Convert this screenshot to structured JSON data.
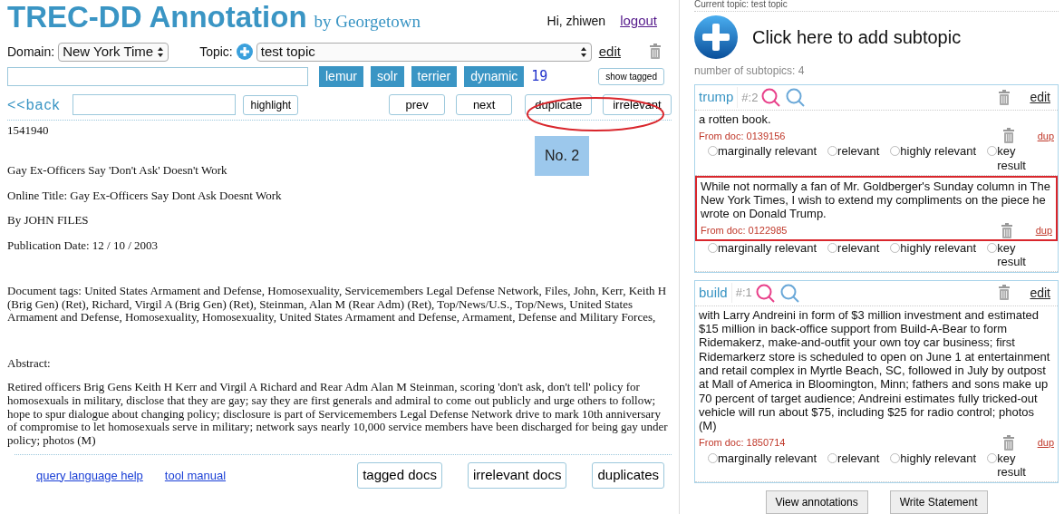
{
  "header": {
    "title": "TREC-DD Annotation",
    "subtitle": "by Georgetown",
    "greeting": "Hi, zhiwen",
    "logout": "logout"
  },
  "controls": {
    "domain_label": "Domain:",
    "domain_value": "New York Time",
    "topic_label": "Topic:",
    "topic_value": "test topic",
    "edit": "edit"
  },
  "search": {
    "engines": [
      {
        "label": "lemur"
      },
      {
        "label": "solr"
      },
      {
        "label": "terrier"
      },
      {
        "label": "dynamic"
      }
    ],
    "count": "19",
    "show_tagged": "show tagged"
  },
  "nav": {
    "back": "<<back",
    "highlight": "highlight",
    "buttons": [
      {
        "label": "prev",
        "circled": false
      },
      {
        "label": "next",
        "circled": false
      },
      {
        "label": "duplicate",
        "circled": true
      },
      {
        "label": "irrelevant",
        "circled": true
      }
    ]
  },
  "document": {
    "id": "1541940",
    "rank_badge": "No. 2",
    "paragraphs": [
      {
        "kind": "line",
        "text": "Gay Ex-Officers Say 'Don't Ask' Doesn't Work"
      },
      {
        "kind": "line",
        "text": "Online Title: Gay Ex-Officers Say Dont Ask Doesnt Work"
      },
      {
        "kind": "line",
        "text": "By JOHN FILES"
      },
      {
        "kind": "line",
        "text": "Publication Date: 12 / 10 / 2003"
      },
      {
        "kind": "block",
        "text": "Document tags: United States Armament and Defense, Homosexuality, Servicemembers Legal Defense Network, Files, John, Kerr, Keith H (Brig Gen) (Ret), Richard, Virgil A (Brig Gen) (Ret), Steinman, Alan M (Rear Adm) (Ret), Top/News/U.S., Top/News, United States Armament and Defense, Homosexuality, Homosexuality, United States Armament and Defense, Armament, Defense and Military Forces,"
      },
      {
        "kind": "block",
        "text": "Abstract:"
      },
      {
        "kind": "line",
        "text": "Retired officers Brig Gens Keith H Kerr and Virgil A Richard and Rear Adm Alan M Steinman, scoring 'don't ask, don't tell' policy for homosexuals in military, disclose that they are gay; say they are first generals and admiral to come out publicly and urge others to follow; hope to spur dialogue about changing policy; disclosure is part of Servicemembers Legal Defense Network drive to mark 10th anniversary of compromise to let homosexuals serve in military; network says nearly 10,000 service members have been discharged for being gay under policy; photos (M)"
      }
    ]
  },
  "footer": {
    "links": [
      "query language help",
      "tool manual"
    ],
    "buttons": [
      "tagged docs",
      "irrelevant docs",
      "duplicates"
    ]
  },
  "panel": {
    "current_topic": "Current topic: test topic",
    "add_subtopic": "Click here to add subtopic",
    "count": "number of subtopics: 4",
    "subtopics": [
      {
        "name": "trump",
        "number": "#:2",
        "edit": "edit",
        "snippets": [
          {
            "text": "a rotten book.",
            "source": "From doc: 0139156",
            "dup": "dup",
            "highlighted": false,
            "grades": [
              {
                "label": "marginally relevant",
                "selected": false
              },
              {
                "label": "relevant",
                "selected": false
              },
              {
                "label": "highly relevant",
                "selected": false
              },
              {
                "label": "key result",
                "selected": false
              }
            ]
          },
          {
            "text": "While not normally a fan of Mr. Goldberger's Sunday column in The New York Times, I wish to extend my compliments on the piece he wrote on Donald Trump.",
            "source": "From doc: 0122985",
            "dup": "dup",
            "highlighted": true,
            "grades": [
              {
                "label": "marginally relevant",
                "selected": false
              },
              {
                "label": "relevant",
                "selected": false
              },
              {
                "label": "highly relevant",
                "selected": false
              },
              {
                "label": "key result",
                "selected": false
              }
            ]
          }
        ]
      },
      {
        "name": "build",
        "number": "#:1",
        "edit": "edit",
        "snippets": [
          {
            "text": "with Larry Andreini in form of $3 million investment and estimated $15 million in back-office support from Build-A-Bear to form Ridemakerz, make-and-outfit your own toy car business; first Ridemarkerz store is scheduled to open on June 1 at entertainment and retail complex in Myrtle Beach, SC, followed in July by outpost at Mall of America in Bloomington, Minn; fathers and sons make up 70 percent of target audience; Andreini estimates fully tricked-out vehicle will run about $75, including $25 for radio control; photos (M)",
            "source": "From doc: 1850714",
            "dup": "dup",
            "highlighted": false,
            "grades": [
              {
                "label": "marginally relevant",
                "selected": false
              },
              {
                "label": "relevant",
                "selected": false
              },
              {
                "label": "highly relevant",
                "selected": false
              },
              {
                "label": "key result",
                "selected": false
              }
            ]
          }
        ]
      }
    ],
    "buttons": [
      "View annotations",
      "Write Statement"
    ]
  }
}
